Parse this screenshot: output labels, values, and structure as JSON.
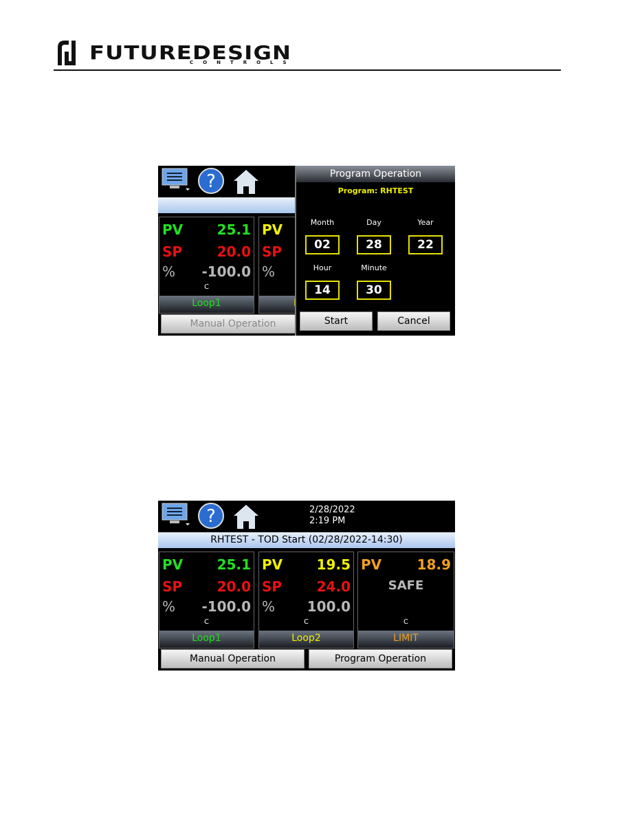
{
  "header": {
    "brand": "FUTUREDESIGN",
    "brand_sub": "CONTROLS"
  },
  "colors": {
    "pv_loop1": "#22e022",
    "pv_loop2": "#f0f000",
    "pv_limit": "#f0a020",
    "sp": "#e81010",
    "percent": "#b8b8b8",
    "field_border": "#e6e000"
  },
  "screen1": {
    "icons": [
      "monitor-menu-icon",
      "help-icon",
      "home-icon"
    ],
    "tile": {
      "pv_label": "PV",
      "pv_value": "25.1",
      "sp_label": "SP",
      "sp_value": "20.0",
      "pct_label": "%",
      "pct_value": "-100.0",
      "unit": "C",
      "name": "Loop1"
    },
    "tile2_partial": {
      "pv_label": "PV",
      "sp_label": "SP",
      "pct_label": "%",
      "name": "L"
    },
    "manual_button": "Manual Operation",
    "dialog": {
      "title": "Program Operation",
      "program": "Program: RHTEST",
      "fields": [
        {
          "label": "Month",
          "value": "02"
        },
        {
          "label": "Day",
          "value": "28"
        },
        {
          "label": "Year",
          "value": "22"
        },
        {
          "label": "Hour",
          "value": "14"
        },
        {
          "label": "Minute",
          "value": "30"
        }
      ],
      "start": "Start",
      "cancel": "Cancel"
    }
  },
  "screen2": {
    "date": "2/28/2022",
    "time": "2:19 PM",
    "status": "RHTEST - TOD Start (02/28/2022-14:30)",
    "tiles": [
      {
        "pv_label": "PV",
        "pv_value": "25.1",
        "sp_label": "SP",
        "sp_value": "20.0",
        "pct_label": "%",
        "pct_value": "-100.0",
        "unit": "C",
        "name": "Loop1"
      },
      {
        "pv_label": "PV",
        "pv_value": "19.5",
        "sp_label": "SP",
        "sp_value": "24.0",
        "pct_label": "%",
        "pct_value": "100.0",
        "unit": "C",
        "name": "Loop2"
      },
      {
        "pv_label": "PV",
        "pv_value": "18.9",
        "state": "SAFE",
        "unit": "C",
        "name": "LIMIT"
      }
    ],
    "manual_button": "Manual Operation",
    "program_button": "Program Operation"
  }
}
